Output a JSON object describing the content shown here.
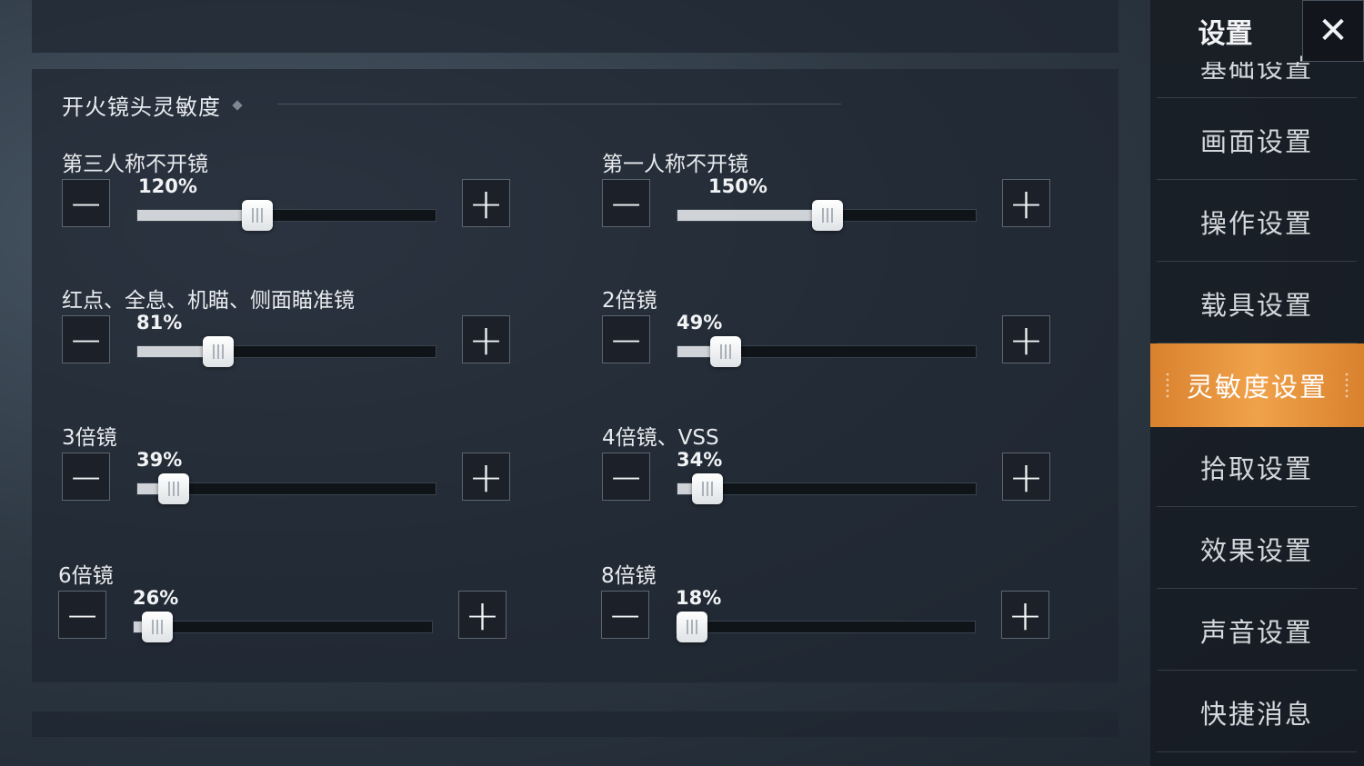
{
  "window": {
    "title": "设置"
  },
  "section": {
    "title": "开火镜头灵敏度"
  },
  "settings": [
    {
      "label": "第三人称不开镜",
      "value": "120%",
      "fill": 0.4
    },
    {
      "label": "第一人称不开镜",
      "value": "150%",
      "fill": 0.5
    },
    {
      "label": "红点、全息、机瞄、侧面瞄准镜",
      "value": "81%",
      "fill": 0.27
    },
    {
      "label": "2倍镜",
      "value": "49%",
      "fill": 0.16
    },
    {
      "label": "3倍镜",
      "value": "39%",
      "fill": 0.12
    },
    {
      "label": "4倍镜、VSS",
      "value": "34%",
      "fill": 0.1
    },
    {
      "label": "6倍镜",
      "value": "26%",
      "fill": 0.08
    },
    {
      "label": "8倍镜",
      "value": "18%",
      "fill": 0.05
    }
  ],
  "controls": {
    "minus_symbol": "−",
    "plus_symbol": "+",
    "close_symbol": "✕"
  },
  "nav": {
    "items": [
      {
        "label": "基础设置"
      },
      {
        "label": "画面设置"
      },
      {
        "label": "操作设置"
      },
      {
        "label": "载具设置"
      },
      {
        "label": "灵敏度设置"
      },
      {
        "label": "拾取设置"
      },
      {
        "label": "效果设置"
      },
      {
        "label": "声音设置"
      },
      {
        "label": "快捷消息"
      }
    ],
    "active_index": 4
  },
  "colors": {
    "accent": "#e8913a",
    "track": "#0f1419",
    "fill": "#cfd3d7"
  }
}
